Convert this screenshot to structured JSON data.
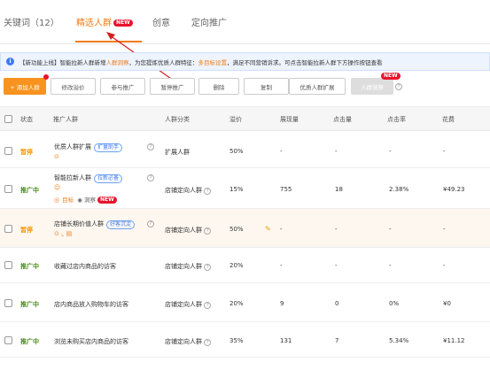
{
  "tabs": [
    {
      "label": "关键词（12）"
    },
    {
      "label": "精选人群"
    },
    {
      "label": "创意"
    },
    {
      "label": "定向推广"
    }
  ],
  "new_badge": "NEW",
  "info": {
    "prefix": "【新功能上线】智能拉新人群新增",
    "highlight1": "人群洞察",
    "middle": "，为您提炼优质人群特征：",
    "highlight2": "多目标设置",
    "suffix": "，满足不同营销诉求。可点击智能拉新人群下方操作按钮查看"
  },
  "toolbar": {
    "add": "+ 添加人群",
    "edit_bid": "修改溢价",
    "join": "参与推广",
    "pause": "暂停推广",
    "delete": "删除",
    "copy": "复制",
    "expand": "优质人群扩展",
    "insight": "人群洞察"
  },
  "table": {
    "headers": {
      "status": "状态",
      "crowd": "推广人群",
      "category": "人群分类",
      "premium": "溢价",
      "impressions": "展现量",
      "clicks": "点击量",
      "ctr": "点击率",
      "cost": "花费"
    },
    "rows": [
      {
        "status": "暂停",
        "name": "优质人群扩展",
        "tag": "扩量助手",
        "category": "扩展人群",
        "premium": "50%",
        "impressions": "-",
        "clicks": "-",
        "ctr": "-",
        "cost": "-"
      },
      {
        "status": "推广中",
        "name": "智能拉新人群",
        "tag": "拉新必备",
        "sub1": "目标",
        "sub2": "洞察",
        "category": "店铺定向人群",
        "premium": "15%",
        "impressions": "755",
        "clicks": "18",
        "ctr": "2.38%",
        "cost": "¥49.23"
      },
      {
        "status": "暂停",
        "name": "店铺长期价值人群",
        "tag": "好客沉淀",
        "category": "店铺定向人群",
        "premium": "50%",
        "impressions": "-",
        "clicks": "-",
        "ctr": "-",
        "cost": "-"
      },
      {
        "status": "推广中",
        "name": "收藏过店内商品的访客",
        "category": "店铺定向人群",
        "premium": "20%",
        "impressions": "-",
        "clicks": "-",
        "ctr": "-",
        "cost": "-"
      },
      {
        "status": "推广中",
        "name": "店内商品放入购物车的访客",
        "category": "店铺定向人群",
        "premium": "20%",
        "impressions": "9",
        "clicks": "0",
        "ctr": "0%",
        "cost": "¥0"
      },
      {
        "status": "推广中",
        "name": "浏览未购买店内商品的访客",
        "category": "店铺定向人群",
        "premium": "35%",
        "impressions": "131",
        "clicks": "7",
        "ctr": "5.34%",
        "cost": "¥11.12"
      }
    ]
  },
  "icons": {
    "info": "info-icon",
    "help": "question-icon",
    "edit": "pencil-icon",
    "target": "target-icon",
    "insight": "eye-icon"
  },
  "colors": {
    "accent": "#f27c16",
    "badge": "#e8142c",
    "active": "#4a8a1a",
    "paused": "#f39800",
    "link": "#3a7bf5"
  }
}
